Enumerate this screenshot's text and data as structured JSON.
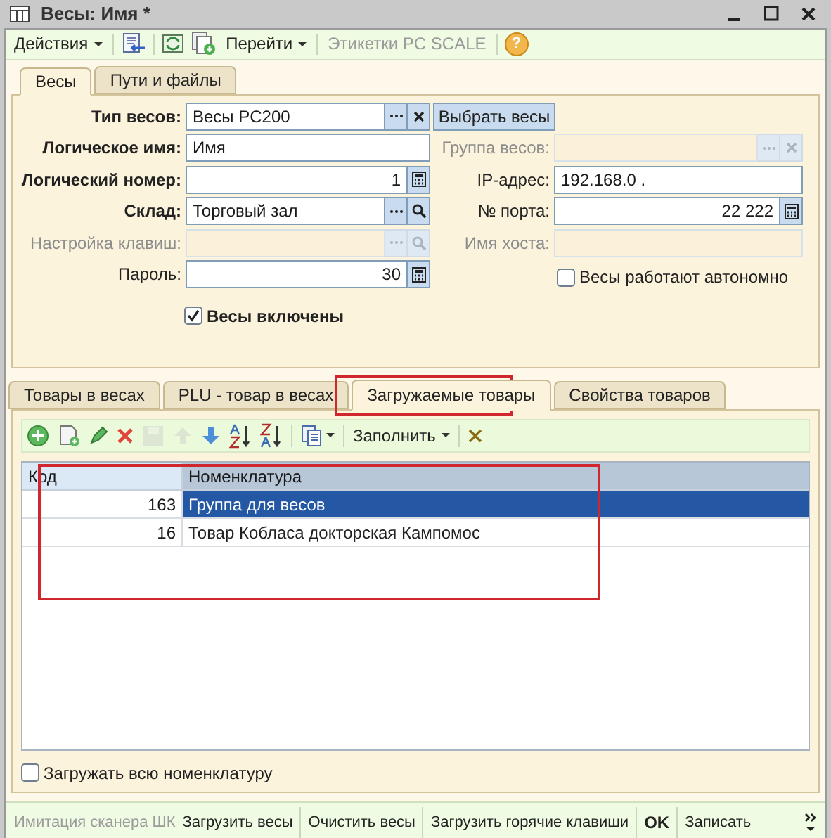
{
  "window": {
    "title": "Весы: Имя *"
  },
  "toolbar": [
    {
      "kind": "menu",
      "label": "Действия"
    },
    {
      "kind": "separator"
    },
    {
      "kind": "import"
    },
    {
      "kind": "separator"
    },
    {
      "kind": "refresh"
    },
    {
      "kind": "copy"
    },
    {
      "kind": "menu",
      "label": "Перейти"
    },
    {
      "kind": "separator"
    },
    {
      "kind": "button",
      "label": "Этикетки PC SCALE",
      "disabled": true
    },
    {
      "kind": "separator"
    },
    {
      "kind": "help",
      "label": "?"
    }
  ],
  "tabs": [
    {
      "label": "Весы",
      "selected": true
    },
    {
      "label": "Пути и файлы",
      "selected": false
    }
  ],
  "left_fields": [
    {
      "label": "Тип весов:",
      "bold": true,
      "value": "Весы PC200",
      "kind": "select_clear",
      "disabled": false
    },
    {
      "label": "Логическое имя:",
      "bold": true,
      "value": "Имя",
      "kind": "text",
      "disabled": false
    },
    {
      "label": "Логический номер:",
      "bold": true,
      "value": "1",
      "kind": "number",
      "disabled": false
    },
    {
      "label": "Склад:",
      "bold": true,
      "value": "Торговый зал",
      "kind": "select_search",
      "disabled": false
    },
    {
      "label": "Настройка клавиш:",
      "bold": false,
      "kind": "select_search",
      "disabled": true
    },
    {
      "label": "Пароль:",
      "bold": false,
      "value": "30",
      "kind": "number",
      "disabled": false
    }
  ],
  "choose_button": "Выбрать весы",
  "right_fields": [
    {
      "label": "Группа весов:",
      "bold": false,
      "kind": "select_clear",
      "disabled": true
    },
    {
      "label": "IP-адрес:",
      "bold": false,
      "value": "192.168.0  .",
      "kind": "text",
      "disabled": false
    },
    {
      "label": "№ порта:",
      "bold": false,
      "value": "22 222",
      "kind": "number",
      "disabled": false
    },
    {
      "label": "Имя хоста:",
      "bold": false,
      "kind": "text",
      "disabled": true
    }
  ],
  "autonomous": {
    "label": "Весы работают автономно",
    "checked": false
  },
  "enabled": {
    "label": "Весы включены",
    "checked": true
  },
  "lower_tabs": [
    {
      "label": "Товары в весах",
      "selected": false
    },
    {
      "label": "PLU - товар в весах",
      "selected": false
    },
    {
      "label": "Загружаемые товары",
      "selected": true
    },
    {
      "label": "Свойства товаров",
      "selected": false
    }
  ],
  "table_toolbar": [
    {
      "kind": "add",
      "disabled": false
    },
    {
      "kind": "add_copy",
      "disabled": false
    },
    {
      "kind": "edit",
      "disabled": false
    },
    {
      "kind": "delete",
      "disabled": false
    },
    {
      "kind": "save",
      "disabled": true
    },
    {
      "kind": "up",
      "disabled": true
    },
    {
      "kind": "down",
      "disabled": false
    },
    {
      "kind": "sort_asc",
      "disabled": false
    },
    {
      "kind": "sort_desc",
      "disabled": false
    },
    {
      "kind": "separator"
    },
    {
      "kind": "copy_menu",
      "disabled": false
    },
    {
      "kind": "separator"
    },
    {
      "kind": "menu",
      "label": "Заполнить",
      "disabled": false
    },
    {
      "kind": "separator"
    },
    {
      "kind": "clear",
      "disabled": false
    }
  ],
  "table": {
    "columns": [
      {
        "label": "Код",
        "selected": false
      },
      {
        "label": "Номенклатура",
        "selected": true
      }
    ],
    "rows": [
      {
        "code": "163",
        "name": "Группа для весов",
        "selected": true
      },
      {
        "code": "16",
        "name": "Товар Кобласа докторская Кампомос",
        "selected": false
      }
    ]
  },
  "load_all": {
    "label": "Загружать всю номенклатуру",
    "checked": false
  },
  "bottom_bar": [
    {
      "kind": "button",
      "label": "Имитация сканера ШК",
      "disabled": true,
      "bold": false
    },
    {
      "kind": "button",
      "label": "Загрузить весы",
      "disabled": false,
      "bold": false
    },
    {
      "kind": "separator"
    },
    {
      "kind": "button",
      "label": "Очистить весы",
      "disabled": false,
      "bold": false
    },
    {
      "kind": "separator"
    },
    {
      "kind": "button",
      "label": "Загрузить горячие клавиши",
      "disabled": false,
      "bold": false
    },
    {
      "kind": "separator"
    },
    {
      "kind": "button",
      "label": "OK",
      "disabled": false,
      "bold": true
    },
    {
      "kind": "separator"
    },
    {
      "kind": "button",
      "label": "Записать",
      "disabled": false,
      "bold": false
    }
  ]
}
